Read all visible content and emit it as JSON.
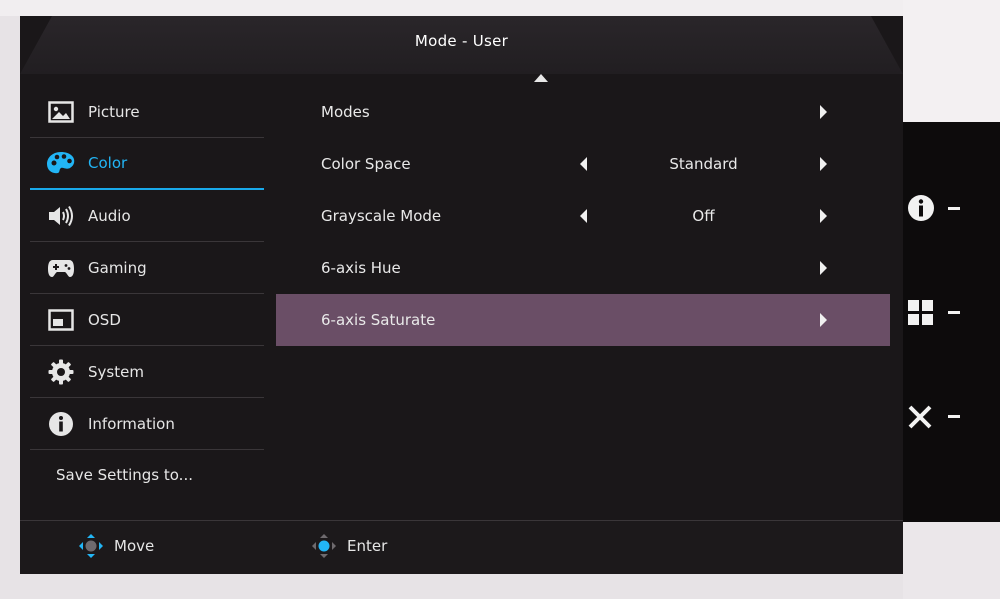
{
  "osd": {
    "title": "Mode - User",
    "sidebar": {
      "items": [
        {
          "label": "Picture",
          "icon": "picture-icon"
        },
        {
          "label": "Color",
          "icon": "palette-icon",
          "active": true
        },
        {
          "label": "Audio",
          "icon": "speaker-icon"
        },
        {
          "label": "Gaming",
          "icon": "gamepad-icon"
        },
        {
          "label": "OSD",
          "icon": "osd-window-icon"
        },
        {
          "label": "System",
          "icon": "gear-icon"
        },
        {
          "label": "Information",
          "icon": "info-icon"
        }
      ],
      "save_label": "Save Settings to..."
    },
    "settings": [
      {
        "label": "Modes",
        "value": ""
      },
      {
        "label": "Color Space",
        "value": "Standard"
      },
      {
        "label": "Grayscale Mode",
        "value": "Off"
      },
      {
        "label": "6-axis Hue",
        "value": ""
      },
      {
        "label": "6-axis Saturate",
        "value": "",
        "selected": true
      }
    ],
    "footer": {
      "move_label": "Move",
      "enter_label": "Enter"
    }
  },
  "hardware_keys": [
    "info-icon",
    "grid-icon",
    "close-icon"
  ],
  "colors": {
    "accent": "#19a9ea",
    "selection": "#6a4e66",
    "background": "#1a1719"
  }
}
